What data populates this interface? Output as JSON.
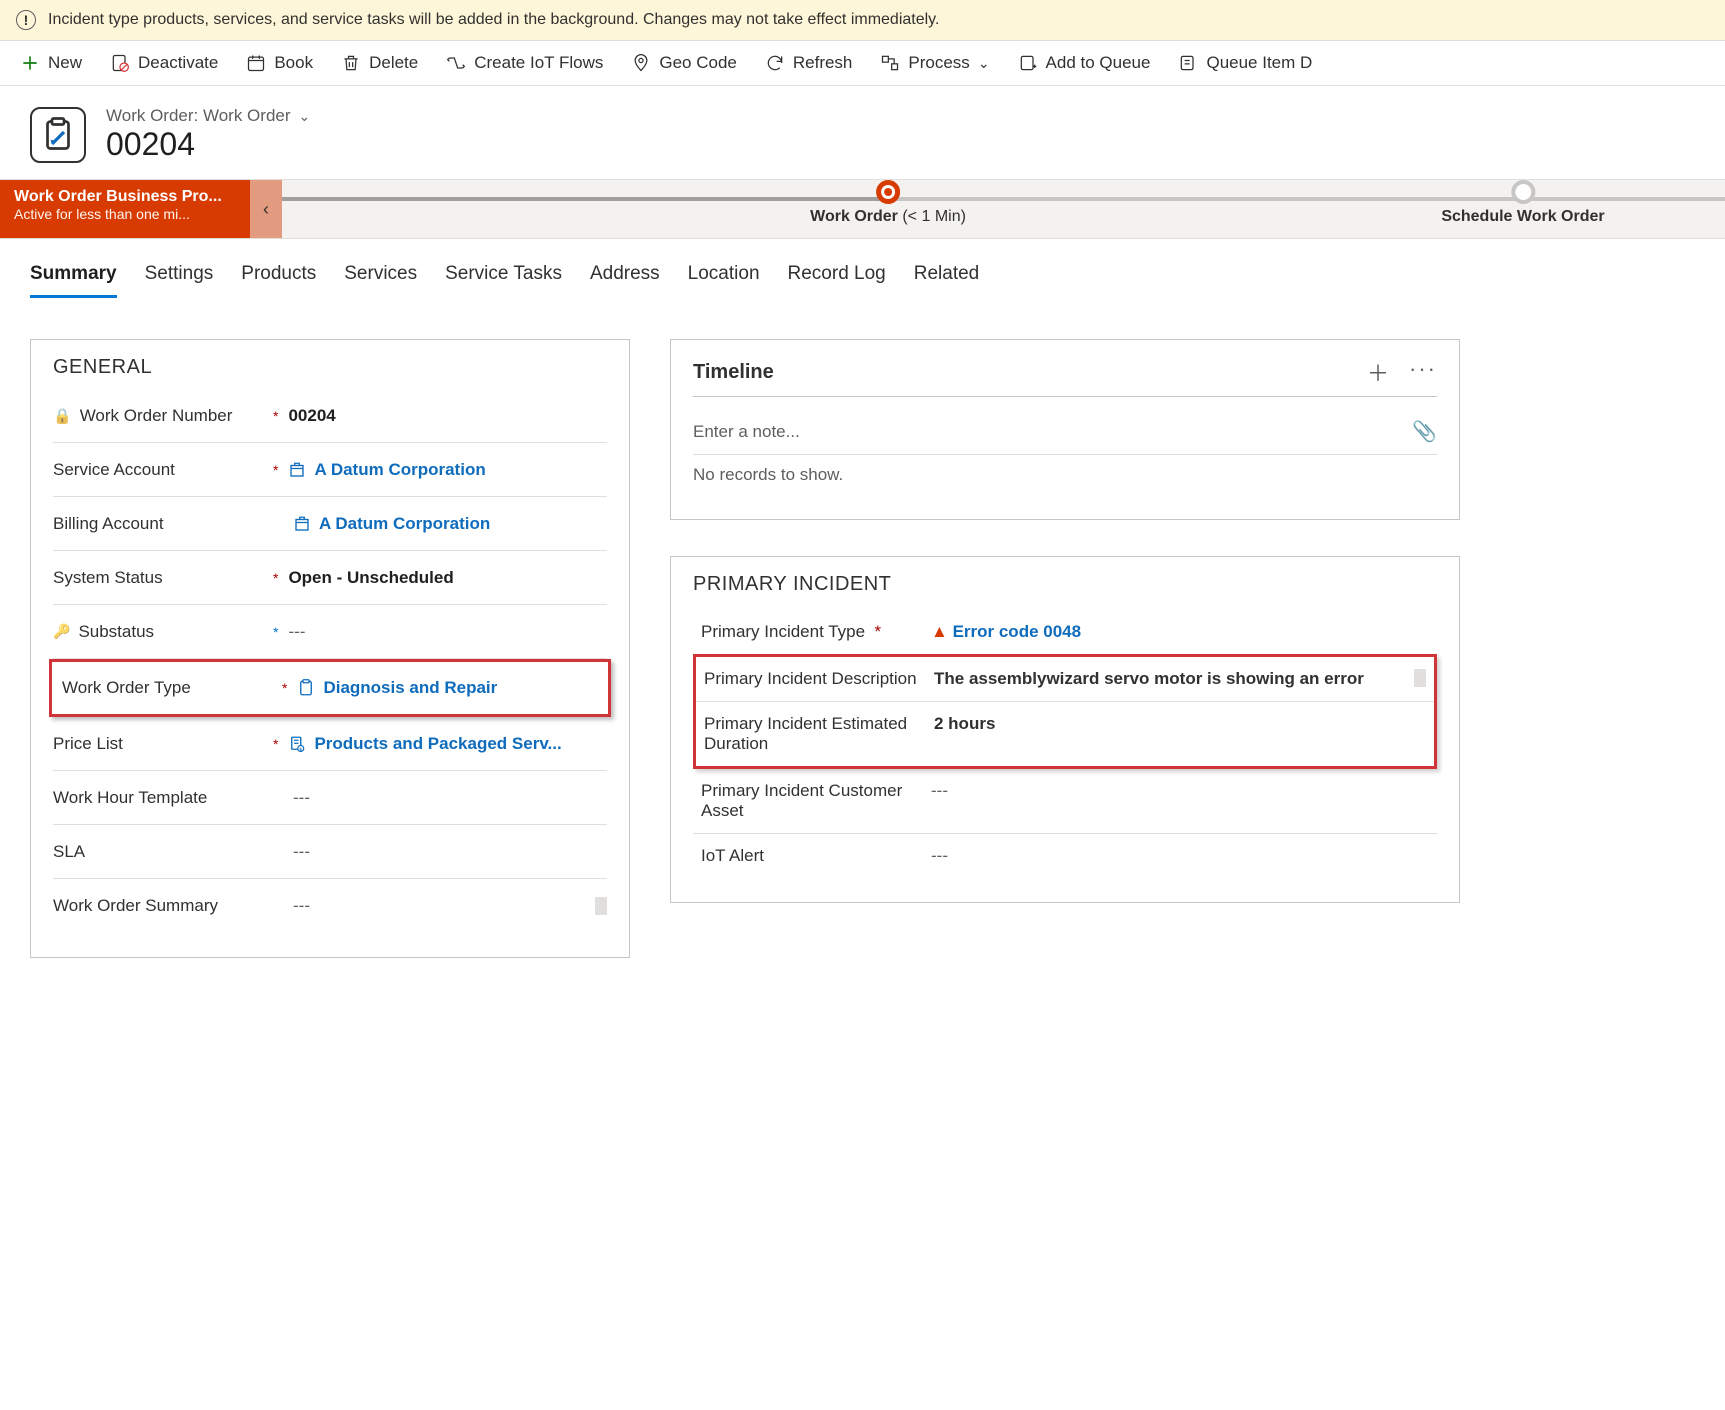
{
  "notification": {
    "text": "Incident type products, services, and service tasks will be added in the background. Changes may not take effect immediately."
  },
  "commands": {
    "new": "New",
    "deactivate": "Deactivate",
    "book": "Book",
    "delete": "Delete",
    "create_iot": "Create IoT Flows",
    "geo_code": "Geo Code",
    "refresh": "Refresh",
    "process": "Process",
    "add_to_queue": "Add to Queue",
    "queue_item": "Queue Item D"
  },
  "header": {
    "form_name": "Work Order: Work Order",
    "record_title": "00204"
  },
  "bpf": {
    "name": "Work Order Business Pro...",
    "status": "Active for less than one mi...",
    "stage1": {
      "label": "Work Order",
      "time": "(< 1 Min)"
    },
    "stage2": {
      "label": "Schedule Work Order"
    }
  },
  "tabs": {
    "summary": "Summary",
    "settings": "Settings",
    "products": "Products",
    "services": "Services",
    "service_tasks": "Service Tasks",
    "address": "Address",
    "location": "Location",
    "record_log": "Record Log",
    "related": "Related"
  },
  "general": {
    "section_title": "GENERAL",
    "fields": {
      "work_order_number": {
        "label": "Work Order Number",
        "value": "00204"
      },
      "service_account": {
        "label": "Service Account",
        "value": "A Datum Corporation"
      },
      "billing_account": {
        "label": "Billing Account",
        "value": "A Datum Corporation"
      },
      "system_status": {
        "label": "System Status",
        "value": "Open - Unscheduled"
      },
      "substatus": {
        "label": "Substatus",
        "value": "---"
      },
      "work_order_type": {
        "label": "Work Order Type",
        "value": "Diagnosis and Repair"
      },
      "price_list": {
        "label": "Price List",
        "value": "Products and Packaged Serv..."
      },
      "work_hour_template": {
        "label": "Work Hour Template",
        "value": "---"
      },
      "sla": {
        "label": "SLA",
        "value": "---"
      },
      "work_order_summary": {
        "label": "Work Order Summary",
        "value": "---"
      }
    }
  },
  "timeline": {
    "title": "Timeline",
    "note_placeholder": "Enter a note...",
    "empty": "No records to show."
  },
  "incident": {
    "section_title": "PRIMARY INCIDENT",
    "type": {
      "label": "Primary Incident Type",
      "value": "Error code 0048"
    },
    "description": {
      "label": "Primary Incident Description",
      "value": "The assemblywizard servo motor is showing an error"
    },
    "duration": {
      "label": "Primary Incident Estimated Duration",
      "value": "2 hours"
    },
    "asset": {
      "label": "Primary Incident Customer Asset",
      "value": "---"
    },
    "iot_alert": {
      "label": "IoT Alert",
      "value": "---"
    }
  },
  "colors": {
    "accent": "#0078d4",
    "danger": "#d13438",
    "bpf": "#d83b01"
  }
}
